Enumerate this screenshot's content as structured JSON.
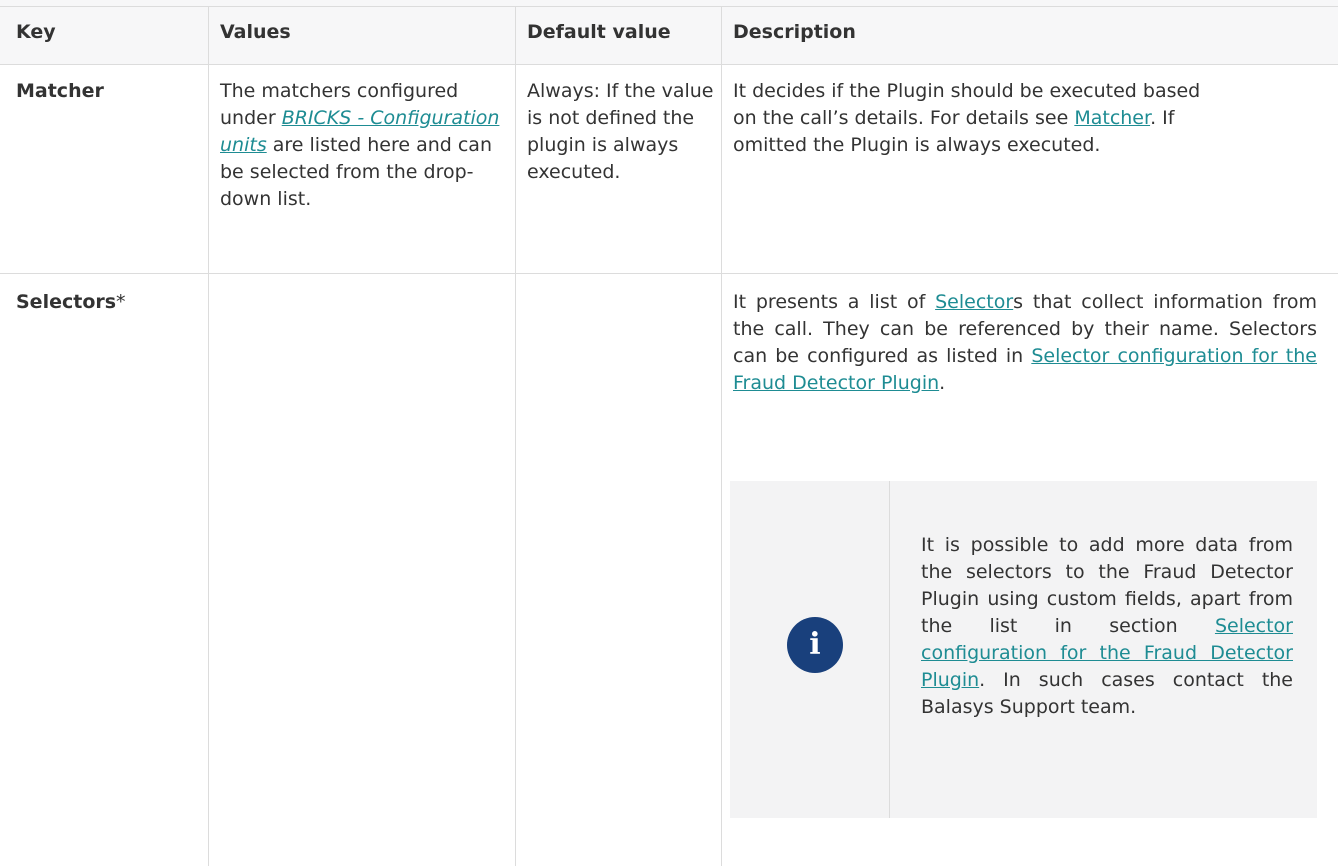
{
  "table": {
    "headers": {
      "key": "Key",
      "values": "Values",
      "default_value": "Default value",
      "description": "Description"
    },
    "rows": [
      {
        "key": "Matcher",
        "values": {
          "prefix": "The matchers configured under ",
          "link": "BRICKS - Configuration units",
          "suffix": " are listed here and can be selected from the drop-down list."
        },
        "default_value": "Always: If the value is not defined the plugin is always executed.",
        "description": {
          "prefix": "It decides if the Plugin should be executed based on the call’s details. For details see ",
          "link": "Matcher",
          "suffix": ". If omitted the Plugin is always executed."
        }
      },
      {
        "key": "Selectors",
        "key_marker": "*",
        "values": "",
        "default_value": "",
        "description": {
          "prefix": "It presents a list of ",
          "link": "Selector",
          "middle": "s that collect information from the call. They can be referenced by their name. Selectors can be configured as listed in ",
          "link2": "Selector configuration for the Fraud Detector Plugin",
          "suffix": "."
        },
        "note": {
          "icon": "info-icon",
          "icon_glyph": "i",
          "prefix": "It is possible to add more data from the selectors to the Fraud Detector Plugin using custom fields, apart from the list in section ",
          "link": "Selector configuration for the Fraud Detector Plugin",
          "suffix": ". In such cases contact the Balasys Support team."
        }
      }
    ]
  },
  "colors": {
    "link": "#1e8c93",
    "header_bg": "#f7f7f8",
    "note_bg": "#f3f3f4",
    "info_icon": "#19407c",
    "border": "#dcdcdc"
  }
}
